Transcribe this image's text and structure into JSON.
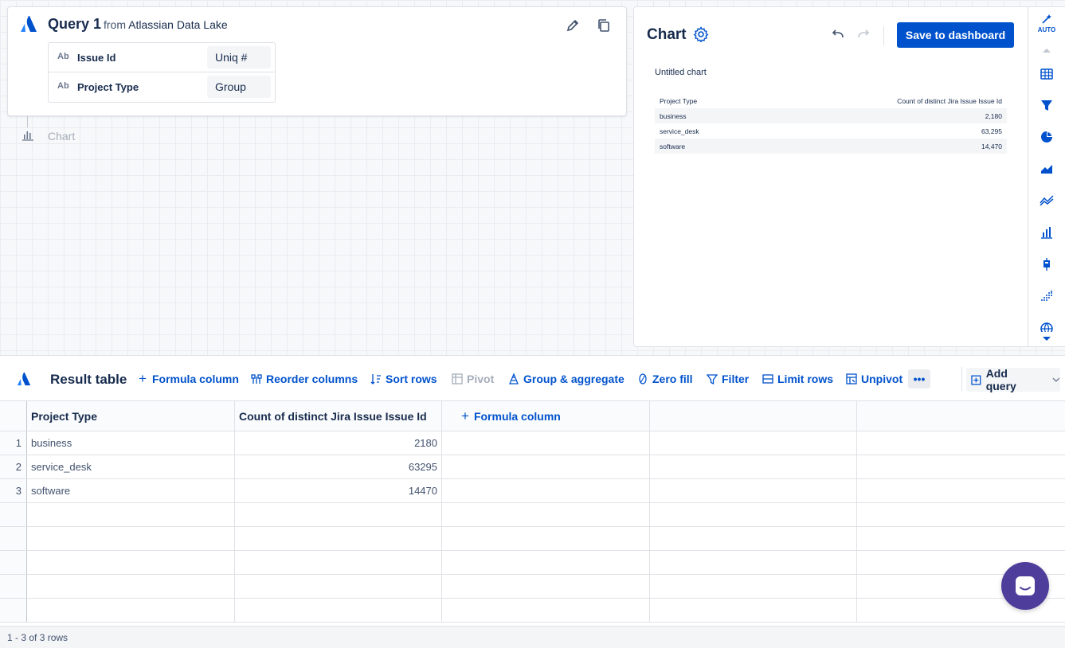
{
  "query": {
    "title": "Query 1",
    "from_prefix": "from",
    "source": "Atlassian Data Lake",
    "fields": [
      {
        "type": "Ab",
        "name": "Issue Id",
        "aggregation": "Uniq #"
      },
      {
        "type": "Ab",
        "name": "Project Type",
        "aggregation": "Group"
      }
    ]
  },
  "chart_node": {
    "label": "Chart"
  },
  "chart_panel": {
    "title": "Chart",
    "save_label": "Save to dashboard",
    "chart_title": "Untitled chart",
    "headers": [
      "Project Type",
      "Count of distinct Jira Issue Issue Id"
    ],
    "rows": [
      {
        "type": "business",
        "count": "2,180"
      },
      {
        "type": "service_desk",
        "count": "63,295"
      },
      {
        "type": "software",
        "count": "14,470"
      }
    ]
  },
  "right_toolbar": {
    "auto_label": "AUTO",
    "icons": [
      "table-icon",
      "funnel-icon",
      "pie-chart-icon",
      "area-chart-icon",
      "line-chart-icon",
      "bar-chart-icon",
      "candlestick-icon",
      "scatter-icon",
      "globe-icon"
    ]
  },
  "result": {
    "title": "Result table",
    "actions": {
      "formula": "Formula column",
      "reorder": "Reorder columns",
      "sort": "Sort rows",
      "pivot": "Pivot",
      "group": "Group & aggregate",
      "zero": "Zero fill",
      "filter": "Filter",
      "limit": "Limit rows",
      "unpivot": "Unpivot",
      "more": "•••",
      "add_query": "Add query"
    },
    "columns": [
      "Project Type",
      "Count of distinct Jira Issue Issue Id"
    ],
    "add_column_label": "Formula column",
    "rows": [
      {
        "n": "1",
        "type": "business",
        "count": "2180"
      },
      {
        "n": "2",
        "type": "service_desk",
        "count": "63295"
      },
      {
        "n": "3",
        "type": "software",
        "count": "14470"
      }
    ],
    "footer": "1 - 3 of 3 rows"
  },
  "colors": {
    "brand": "#0052cc",
    "chat": "#4e3d9b"
  }
}
